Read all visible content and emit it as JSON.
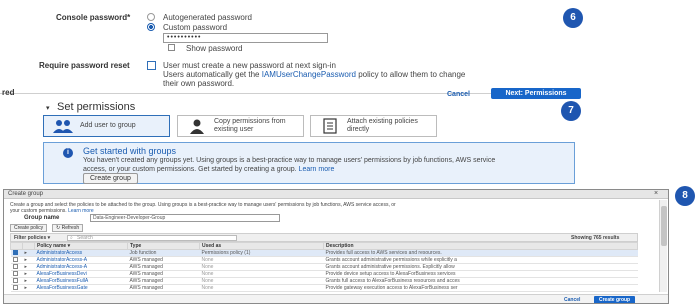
{
  "password_section": {
    "console_password_label": "Console password*",
    "options": [
      "Autogenerated password",
      "Custom password"
    ],
    "password_value": "••••••••••",
    "show_password_label": "Show password",
    "reset_label": "Require password reset",
    "reset_text_line1": "User must create a new password at next sign-in",
    "reset_text_line2_prefix": "Users automatically get the ",
    "reset_text_line2_link": "IAMUserChangePassword",
    "reset_text_line2_suffix": " policy to allow them to change",
    "reset_text_line3": "their own password."
  },
  "steps": [
    "6",
    "7",
    "8"
  ],
  "nav": {
    "required_fragment": "red",
    "cancel": "Cancel",
    "next": "Next: Permissions"
  },
  "permissions": {
    "caret": "▾",
    "title": "Set permissions",
    "options": [
      {
        "label_line1": "Add user to group",
        "label_line2": ""
      },
      {
        "label_line1": "Copy permissions from",
        "label_line2": "existing user"
      },
      {
        "label_line1": "Attach existing policies",
        "label_line2": "directly"
      }
    ],
    "info_icon": "i",
    "info_title": "Get started with groups",
    "info_line1": "You haven't created any groups yet. Using groups is a best-practice way to manage users' permissions by job functions, AWS service",
    "info_line2_prefix": "access, or your custom permissions. Get started by creating a group. ",
    "info_line2_link": "Learn more",
    "create_group_btn": "Create group"
  },
  "dialog": {
    "title": "Create group",
    "close": "×",
    "description_line1": "Create a group and select the policies to be attached to the group. Using groups is a best-practice way to manage users' permissions by job functions, AWS service access, or",
    "description_line2_prefix": "your custom permissions. ",
    "description_line2_link": "Learn more",
    "group_name_label": "Group name",
    "group_name_value": "Data-Engineer-Developer-Group",
    "create_policy_btn": "Create policy",
    "refresh_btn": "Refresh",
    "filter_label": "Filter policies ▾",
    "search_placeholder": "Search",
    "showing": "Showing 765 results",
    "columns": [
      "",
      "",
      "Policy name ▾",
      "Type",
      "Used as",
      "Description"
    ],
    "rows": [
      {
        "checked": true,
        "name": "AdministratorAccess",
        "type": "Job function",
        "used": "Permissions policy (1)",
        "desc": "Provides full access to AWS services and resources."
      },
      {
        "checked": false,
        "name": "AdministratorAccess-A",
        "type": "AWS managed",
        "used": "None",
        "desc": "Grants account administrative permissions while explicitly a"
      },
      {
        "checked": false,
        "name": "AdministratorAccess-A",
        "type": "AWS managed",
        "used": "None",
        "desc": "Grants account administrative permissions. Explicitly allow"
      },
      {
        "checked": false,
        "name": "AlexaForBusinessDevi",
        "type": "AWS managed",
        "used": "None",
        "desc": "Provide device setup access to AlexaForBusiness services"
      },
      {
        "checked": false,
        "name": "AlexaForBusinessFullA",
        "type": "AWS managed",
        "used": "None",
        "desc": "Grants full access to AlexaForBusiness resources and acces"
      },
      {
        "checked": false,
        "name": "AlexaForBusinessGate",
        "type": "AWS managed",
        "used": "None",
        "desc": "Provide gateway execution access to AlexaForBusiness ser"
      }
    ],
    "cancel": "Cancel",
    "create_btn": "Create group"
  },
  "colors": {
    "primary": "#1866c9",
    "step_badge": "#1f56b0",
    "link": "#1a5cb0",
    "info_bg": "#e9f1fb"
  }
}
